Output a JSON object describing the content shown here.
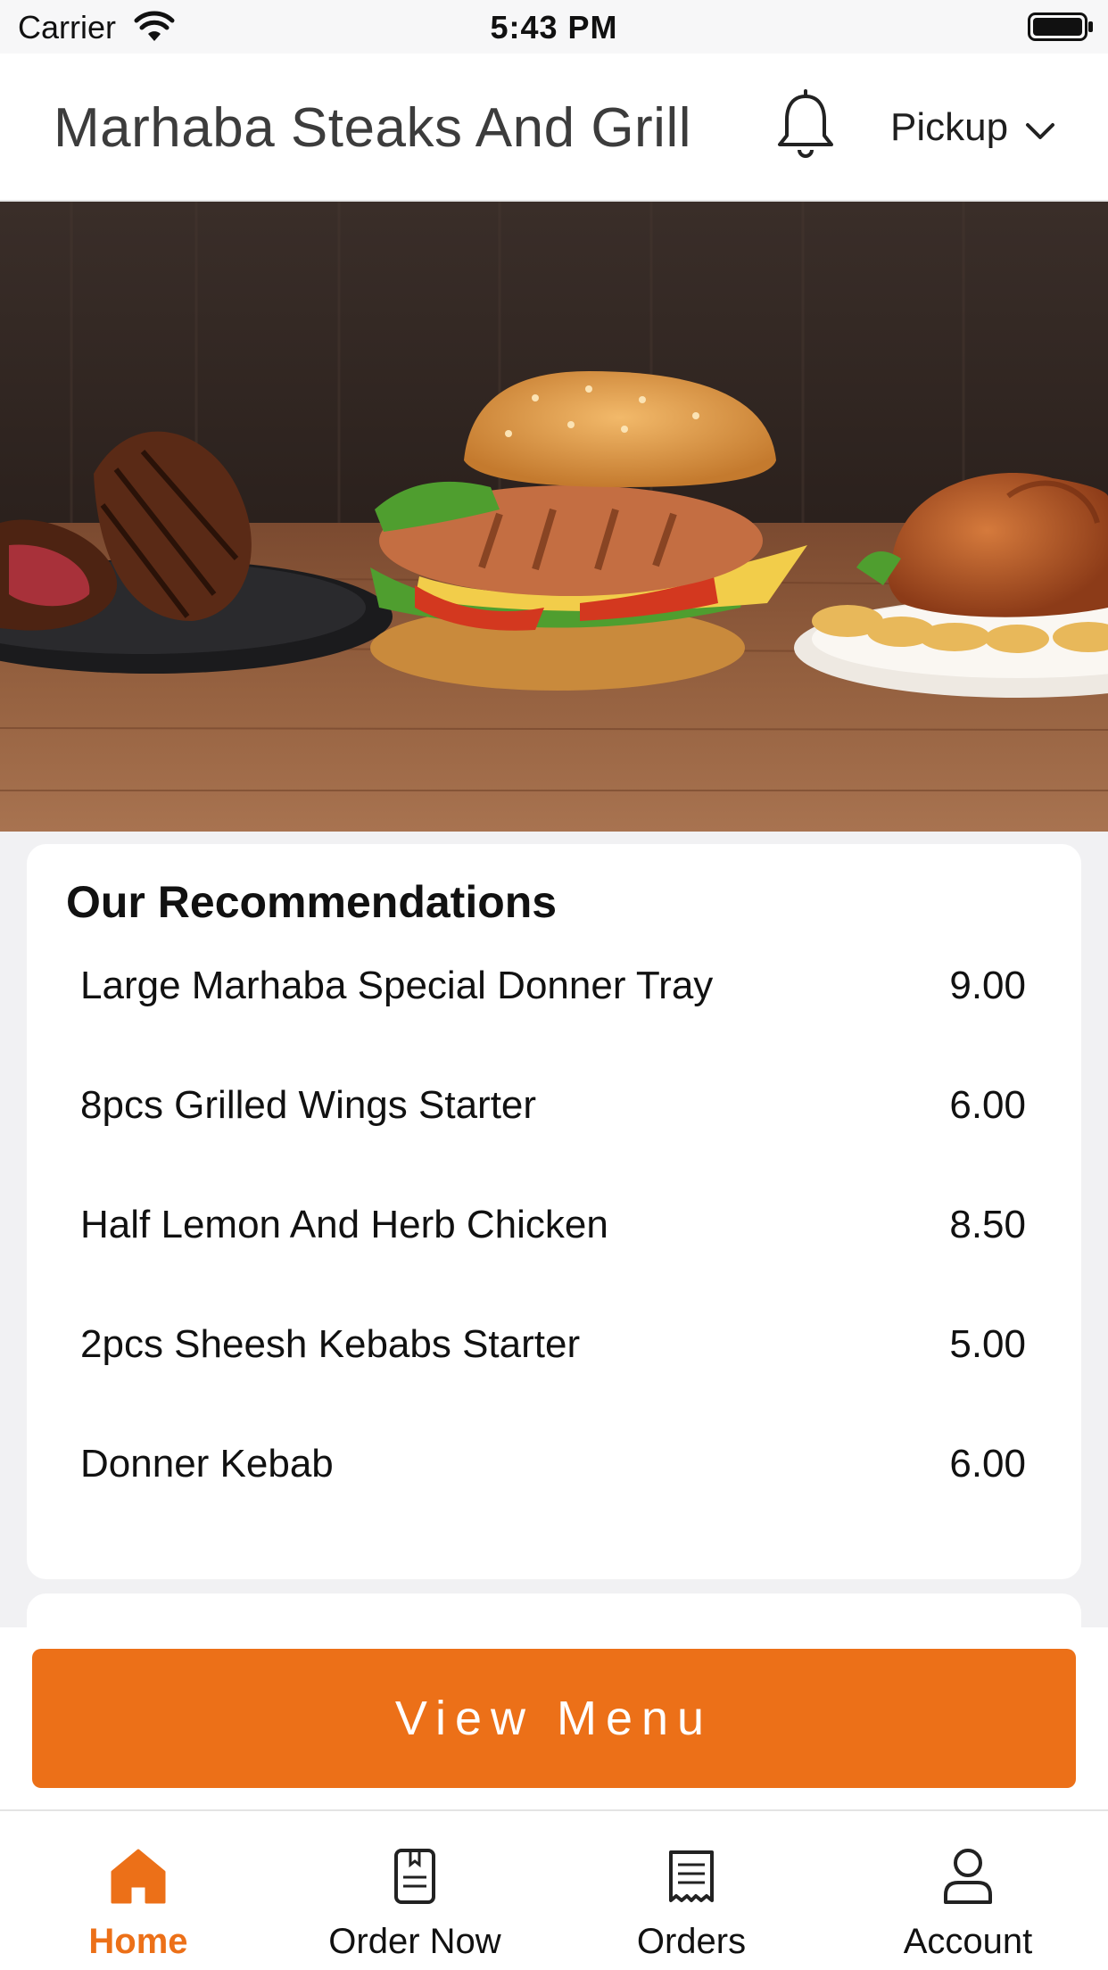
{
  "status_bar": {
    "carrier": "Carrier",
    "time": "5:43 PM"
  },
  "header": {
    "title": "Marhaba Steaks And Grill",
    "order_mode": "Pickup"
  },
  "recommendations": {
    "title": "Our Recommendations",
    "items": [
      {
        "name": "Large Marhaba Special Donner Tray",
        "price": "9.00"
      },
      {
        "name": "8pcs Grilled Wings Starter",
        "price": "6.00"
      },
      {
        "name": "Half Lemon And Herb Chicken",
        "price": "8.50"
      },
      {
        "name": "2pcs Sheesh Kebabs Starter",
        "price": "5.00"
      },
      {
        "name": "Donner Kebab",
        "price": "6.00"
      }
    ]
  },
  "cta": {
    "label": "View Menu"
  },
  "tabs": [
    {
      "label": "Home",
      "icon": "home-icon",
      "active": true
    },
    {
      "label": "Order Now",
      "icon": "order-icon",
      "active": false
    },
    {
      "label": "Orders",
      "icon": "receipt-icon",
      "active": false
    },
    {
      "label": "Account",
      "icon": "user-icon",
      "active": false
    }
  ],
  "colors": {
    "accent": "#ec7018",
    "background": "#f1f1f3",
    "card": "#ffffff"
  }
}
